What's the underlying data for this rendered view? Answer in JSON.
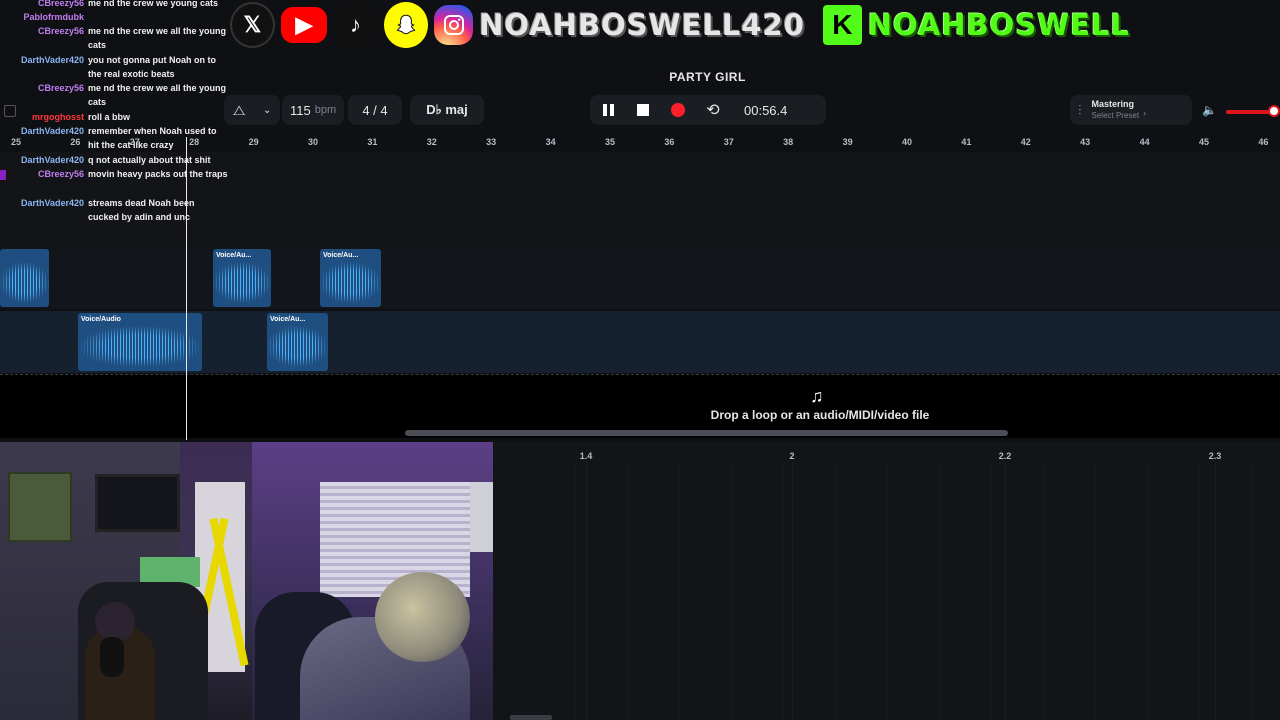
{
  "banner": {
    "socials": [
      "x-logo",
      "youtube-logo",
      "tiktok-logo",
      "snapchat-logo",
      "instagram-logo"
    ],
    "instagram_handle": "NOAHBOSWELL420",
    "kick_letter": "K",
    "kick_handle": "NOAHBOSWELL"
  },
  "chat": [
    {
      "user": "CBreezy56",
      "text": "me nd the crew we young cats"
    },
    {
      "user": "Pablofrmdubk",
      "text": ""
    },
    {
      "user": "CBreezy56",
      "text": "me nd the crew we all the young cats"
    },
    {
      "user": "DarthVader420",
      "text": "you not gonna put Noah on to the real exotic beats"
    },
    {
      "user": "CBreezy56",
      "text": "me nd the crew we all the young cats"
    },
    {
      "user": "mrgoghosst",
      "text": "roll a bbw"
    },
    {
      "user": "DarthVader420",
      "text": "remember when Noah used to hit the cat like crazy"
    },
    {
      "user": "DarthVader420",
      "text": "q not actually about that shit"
    },
    {
      "user": "CBreezy56",
      "text": "movin heavy packs out the traps"
    },
    {
      "user": "DarthVader420",
      "text": "streams dead Noah been cucked by adin and unc"
    }
  ],
  "daw": {
    "song_title": "PARTY GIRL",
    "tempo_value": "115",
    "tempo_unit": "bpm",
    "time_signature": "4 / 4",
    "key": "D♭ maj",
    "time_display": "00:56.4",
    "mastering_label": "Mastering",
    "mastering_preset": "Select Preset",
    "ruler": [
      "25",
      "26",
      "27",
      "28",
      "29",
      "30",
      "31",
      "32",
      "33",
      "34",
      "35",
      "36",
      "37",
      "38",
      "39",
      "40",
      "41",
      "42",
      "43",
      "44",
      "45",
      "46"
    ],
    "clips": {
      "lane2": [
        "",
        "Voice/Au...",
        "Voice/Au..."
      ],
      "lane3": [
        "Voice/Audio",
        "Voice/Au..."
      ]
    },
    "drop_text": "Drop a loop or an audio/MIDI/video file",
    "lower_ruler": [
      "1.4",
      "2",
      "2.2",
      "2.3"
    ]
  },
  "colors": {
    "accent_blue": "#4db3ff",
    "record_red": "#ff1f2a",
    "kick_green": "#53fc18",
    "volume_red": "#e0141e"
  }
}
